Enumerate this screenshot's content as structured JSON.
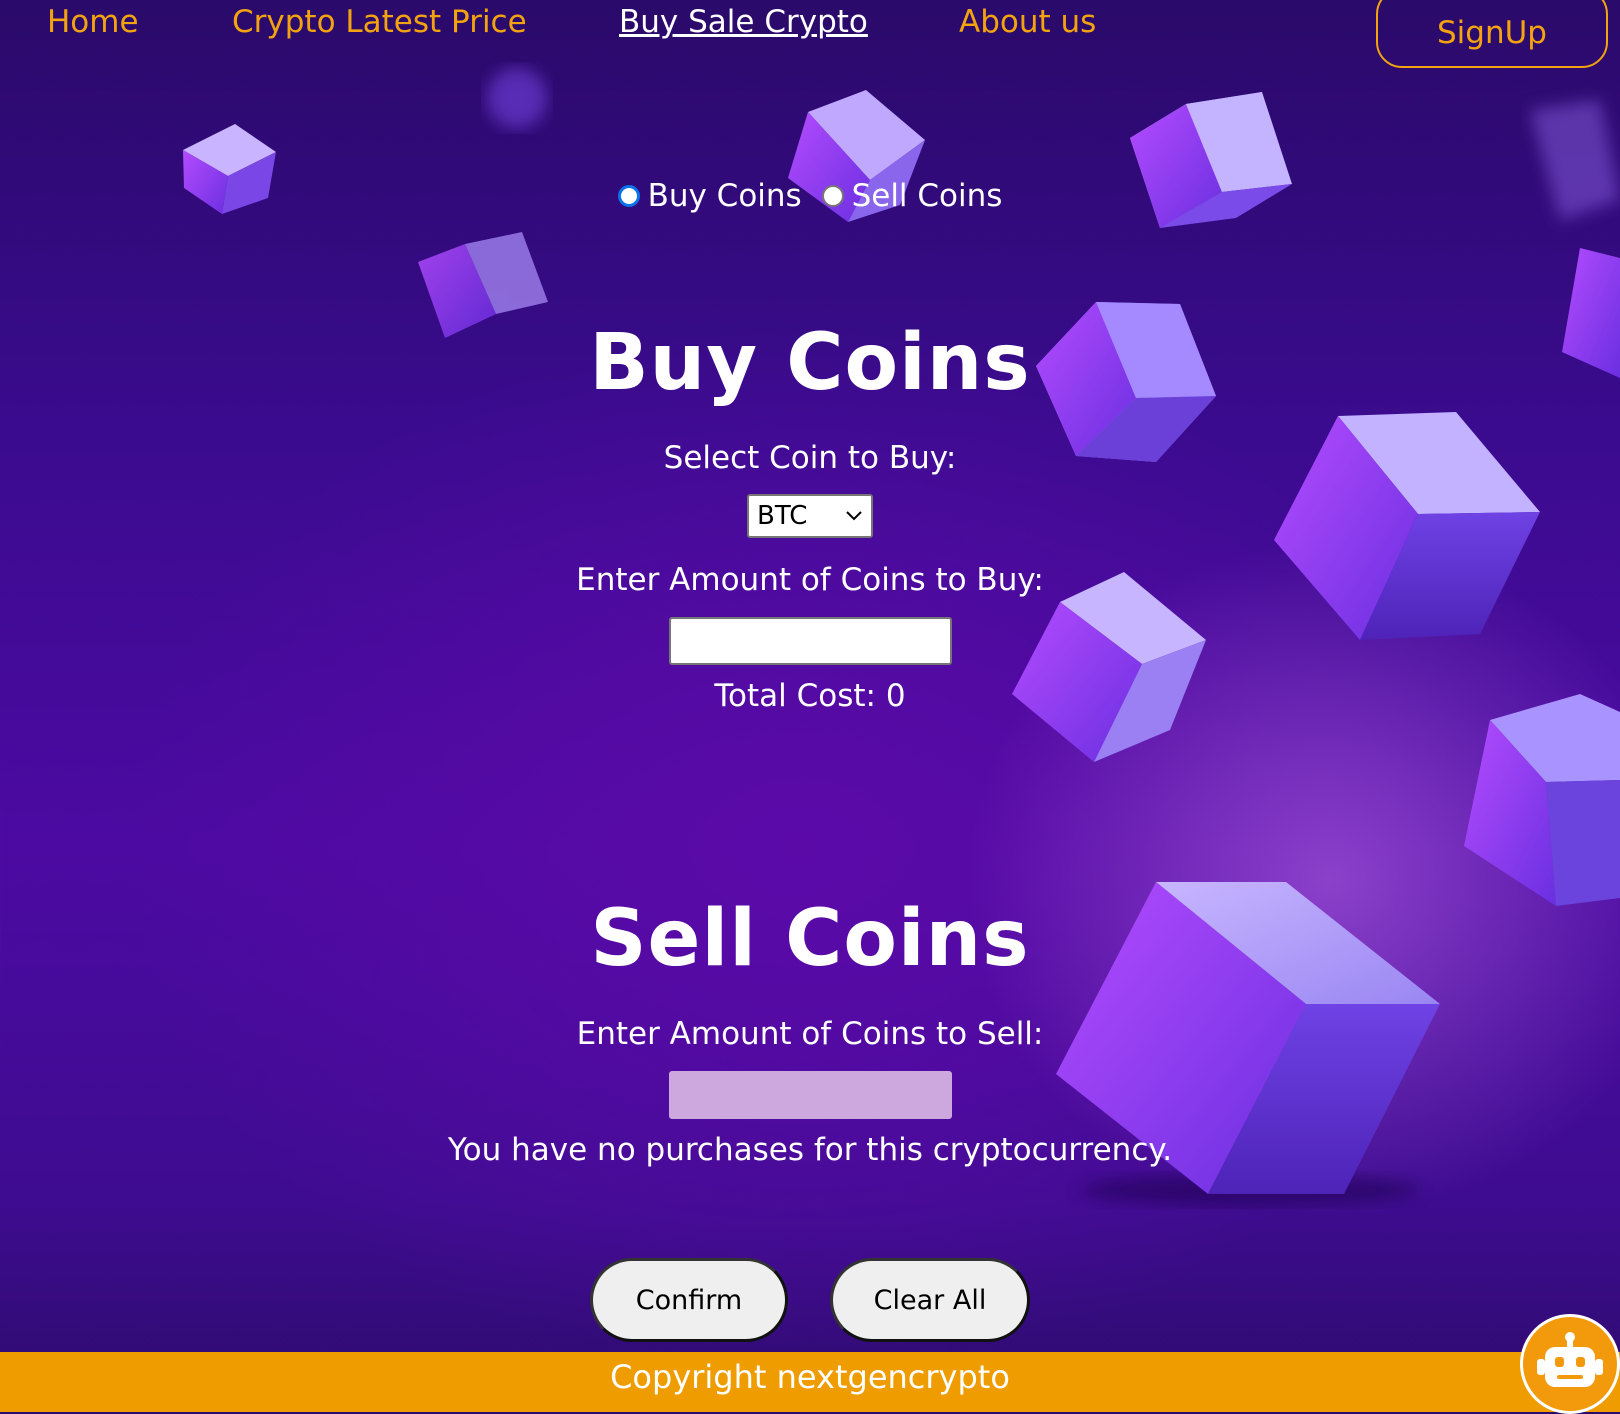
{
  "nav": {
    "links": [
      "Home",
      "Crypto Latest Price",
      "Buy Sale Crypto",
      "About us"
    ],
    "signup_label": "SignUp"
  },
  "mode": {
    "buy_label": "Buy Coins",
    "sell_label": "Sell Coins",
    "selected": "Buy Coins"
  },
  "buy": {
    "title": "Buy Coins",
    "select_label": "Select Coin to Buy:",
    "selected_coin": "BTC",
    "amount_label": "Enter Amount of Coins to Buy:",
    "amount_value": "",
    "total_cost": "Total Cost: 0"
  },
  "sell": {
    "title": "Sell Coins",
    "amount_label": "Enter Amount of Coins to Sell:",
    "amount_value": "",
    "message": "You have no purchases for this cryptocurrency."
  },
  "actions": {
    "confirm_label": "Confirm",
    "clear_label": "Clear All"
  },
  "footer": {
    "copyright": "Copyright nextgencrypto"
  },
  "chatbot": {
    "icon": "robot-icon"
  },
  "colors": {
    "accent": "#f2a30f",
    "footer_bg": "#ee9c00",
    "background": "#3a0b8e"
  }
}
